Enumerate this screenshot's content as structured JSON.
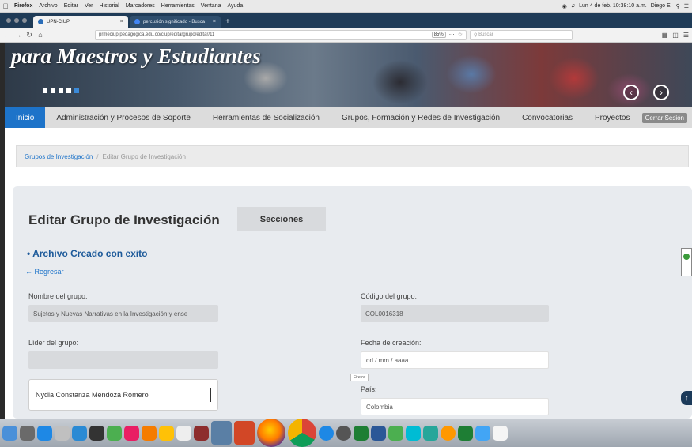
{
  "menubar": {
    "app": "Firefox",
    "items": [
      "Archivo",
      "Editar",
      "Ver",
      "Historial",
      "Marcadores",
      "Herramientas",
      "Ventana",
      "Ayuda"
    ],
    "clock": "Lun 4 de feb. 10:38:10 a.m.",
    "user": "Diego E."
  },
  "tabs": [
    {
      "title": "UPN-CIUP"
    },
    {
      "title": "percusión significado - Busca"
    }
  ],
  "url": "prmeciup.pedagogica.edu.co/ciup/editargrupo/editar/11",
  "zoom": "85%",
  "search_placeholder": "Buscar",
  "banner": {
    "title": "para Maestros y Estudiantes"
  },
  "menu": {
    "items": [
      "Inicio",
      "Administración y Procesos de Soporte",
      "Herramientas de Socialización",
      "Grupos, Formación y Redes de Investigación",
      "Convocatorias",
      "Proyectos"
    ],
    "logout": "Cerrar Sesión"
  },
  "breadcrumb": {
    "link": "Grupos de Investigación",
    "current": "Editar Grupo de Investigación"
  },
  "form": {
    "title": "Editar Grupo de Investigación",
    "sections_button": "Secciones",
    "success_message": "Archivo Creado con exito",
    "back_link": "Regresar",
    "group_name_label": "Nombre del grupo:",
    "group_name_value": "Sujetos y Nuevas Narrativas en la Investigación y ense",
    "group_code_label": "Código del grupo:",
    "group_code_value": "COL0016318",
    "leader_label": "Líder del grupo:",
    "leader_value": "",
    "creation_date_label": "Fecha de creación:",
    "creation_date_value": "dd / mm / aaaa",
    "leader_select_value": "Nydia Constanza Mendoza Romero",
    "country_label": "País:",
    "country_value": "Colombia",
    "tooltip": "Firefox"
  }
}
